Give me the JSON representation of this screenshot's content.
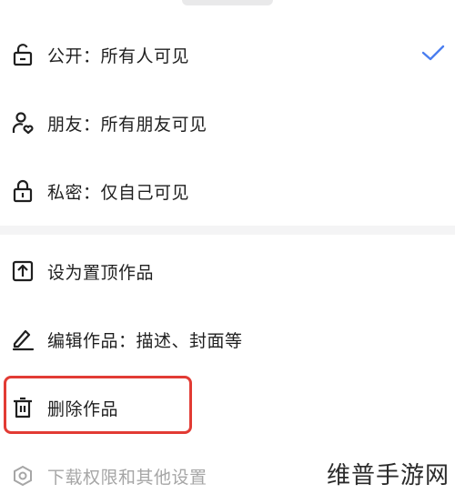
{
  "privacy_options": [
    {
      "label": "公开：所有人可见",
      "icon": "unlock-icon",
      "selected": true
    },
    {
      "label": "朋友：所有朋友可见",
      "icon": "friends-icon",
      "selected": false
    },
    {
      "label": "私密：仅自己可见",
      "icon": "lock-icon",
      "selected": false
    }
  ],
  "actions": [
    {
      "label": "设为置顶作品",
      "icon": "pin-top-icon"
    },
    {
      "label": "编辑作品：描述、封面等",
      "icon": "edit-icon"
    },
    {
      "label": "删除作品",
      "icon": "trash-icon"
    },
    {
      "label": "下载权限和其他设置",
      "icon": "settings-icon"
    }
  ],
  "colors": {
    "accent": "#4a7ef0",
    "highlight": "#e23b34",
    "text": "#1f1f1f",
    "muted": "#a6a6a6"
  },
  "watermark": "维普手游网"
}
